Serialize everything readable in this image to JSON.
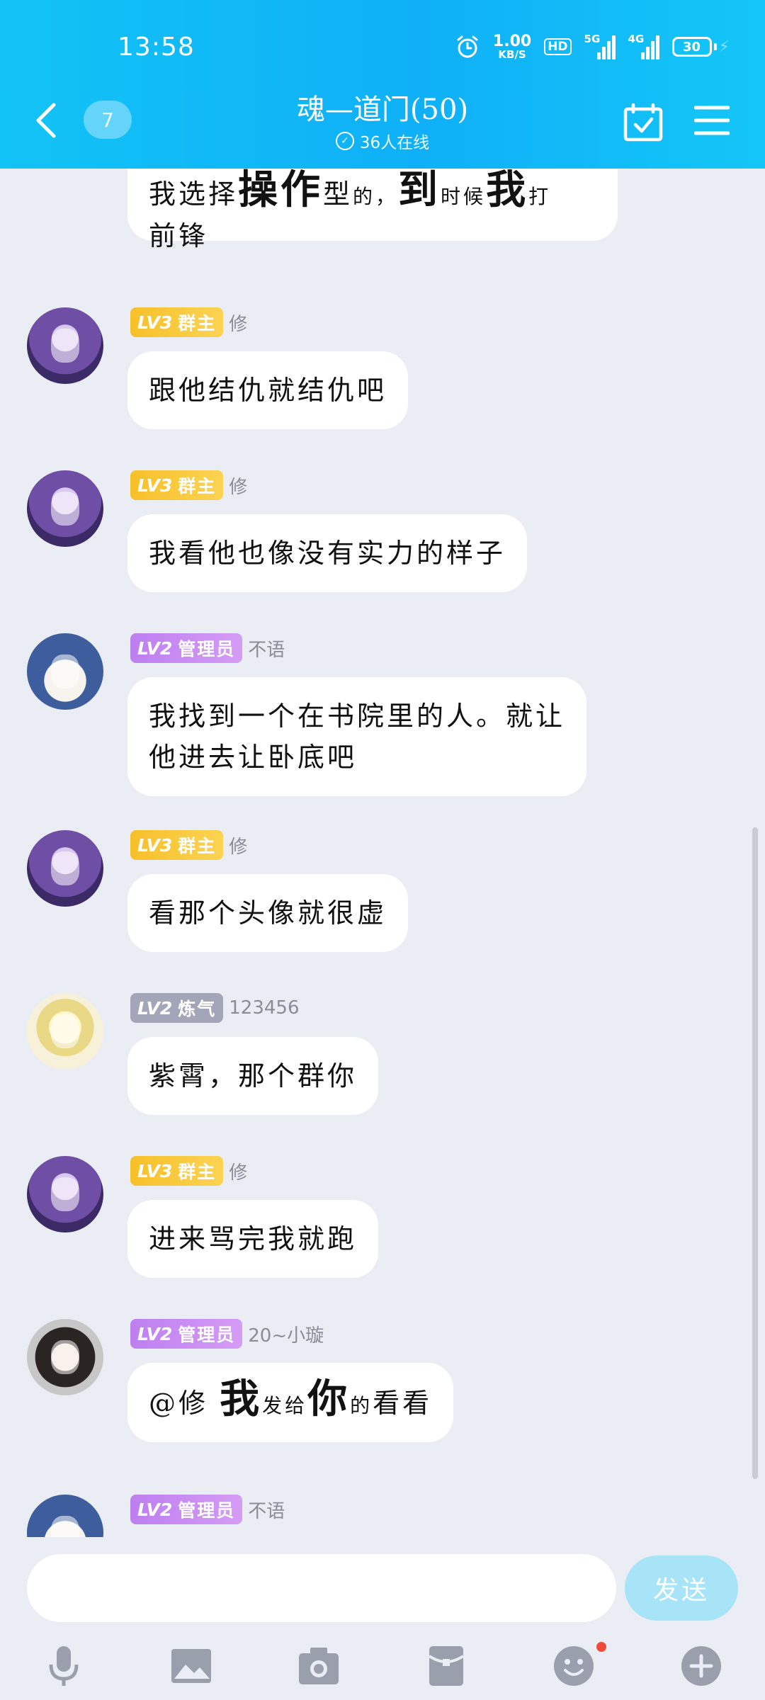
{
  "status_bar": {
    "time": "13:58",
    "net_speed_value": "1.00",
    "net_speed_unit": "KB/S",
    "hd_label": "HD",
    "signal_1_label": "5G",
    "signal_2_label": "4G",
    "battery": "30"
  },
  "header": {
    "unread_count": "7",
    "title": "魂—道门(50)",
    "online_text": "36人在线"
  },
  "messages": [
    {
      "id": "m0",
      "text_parts": [
        "我选择",
        "操作",
        "型",
        "的，",
        "到",
        "时候",
        "我",
        "打",
        "前锋"
      ]
    },
    {
      "id": "m1",
      "level": "LV3",
      "role": "群主",
      "nick": "修",
      "text": "跟他结仇就结仇吧"
    },
    {
      "id": "m2",
      "level": "LV3",
      "role": "群主",
      "nick": "修",
      "text": "我看他也像没有实力的样子"
    },
    {
      "id": "m3",
      "level": "LV2",
      "role": "管理员",
      "nick": "不语",
      "text_line1": "我找到一个在书院里的人。就让",
      "text_line2": "他进去让卧底吧"
    },
    {
      "id": "m4",
      "level": "LV3",
      "role": "群主",
      "nick": "修",
      "text": "看那个头像就很虚"
    },
    {
      "id": "m5",
      "level": "LV2",
      "role": "炼气",
      "nick": "123456",
      "text": "紫霄，那个群你"
    },
    {
      "id": "m6",
      "level": "LV3",
      "role": "群主",
      "nick": "修",
      "text": "进来骂完我就跑"
    },
    {
      "id": "m7",
      "level": "LV2",
      "role": "管理员",
      "nick": "20~小璇",
      "text_parts": [
        "@修 ",
        "我",
        "发给",
        "你",
        "的",
        "看看"
      ]
    },
    {
      "id": "m8",
      "level": "LV2",
      "role": "管理员",
      "nick": "不语"
    }
  ],
  "input": {
    "placeholder": "",
    "send_label": "发送"
  },
  "toolbar": {
    "icons": [
      "microphone-icon",
      "image-icon",
      "camera-icon",
      "red-packet-icon",
      "emoji-icon",
      "plus-icon"
    ]
  },
  "colors": {
    "header_gradient_start": "#12c3f5",
    "header_gradient_end": "#0fb0f7",
    "badge_owner": "#f7c02a",
    "badge_admin": "#bd7ff0",
    "badge_member": "#a3a6b8",
    "send_button": "#a8e4f7",
    "chat_background": "#ebedf4"
  }
}
